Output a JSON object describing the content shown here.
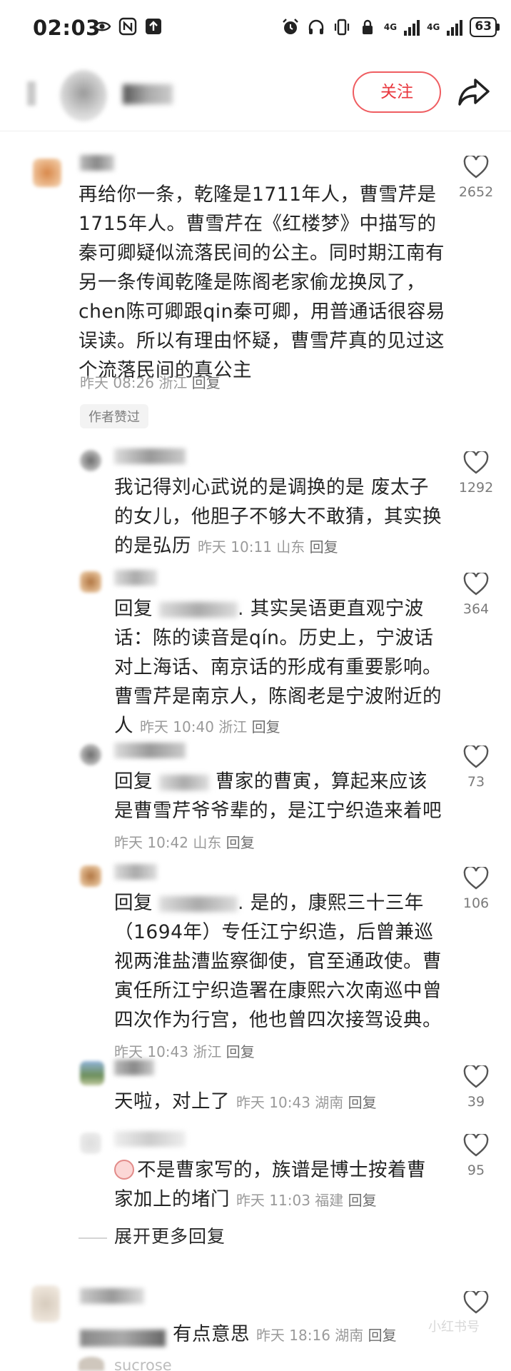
{
  "status_bar": {
    "time": "02:03",
    "network_1": "4G",
    "network_2": "4G",
    "battery": "63"
  },
  "header": {
    "follow_label": "关注"
  },
  "comments": [
    {
      "text": "再给你一条，乾隆是1711年人，曹雪芹是1715年人。曹雪芹在《红楼梦》中描写的秦可卿疑似流落民间的公主。同时期江南有另一条传闻乾隆是陈阁老家偷龙换凤了，chen陈可卿跟qin秦可卿，用普通话很容易误读。所以有理由怀疑，曹雪芹真的见过这个流落民间的真公主",
      "time": "昨天 08:26",
      "location": "浙江",
      "reply_label": "回复",
      "likes": "2652",
      "badge": "作者赞过"
    },
    {
      "text": "我记得刘心武说的是调换的是 废太子的女儿，他胆子不够大不敢猜，其实换的是弘历",
      "time": "昨天 10:11",
      "location": "山东",
      "reply_label": "回复",
      "likes": "1292"
    },
    {
      "prefix": "回复",
      "text": ". 其实吴语更直观宁波话：陈的读音是qín。历史上，宁波话对上海话、南京话的形成有重要影响。曹雪芹是南京人，陈阁老是宁波附近的人",
      "time": "昨天 10:40",
      "location": "浙江",
      "reply_label": "回复",
      "likes": "364"
    },
    {
      "prefix": "回复",
      "text": "曹家的曹寅，算起来应该是曹雪芹爷爷辈的，是江宁织造来着吧",
      "time": "昨天 10:42",
      "location": "山东",
      "reply_label": "回复",
      "likes": "73"
    },
    {
      "prefix": "回复",
      "text": ". 是的，康熙三十三年（1694年）专任江宁织造，后曾兼巡视两淮盐漕监察御使，官至通政使。曹寅任所江宁织造署在康熙六次南巡中曾四次作为行宫，他也曾四次接驾设典。",
      "time": "昨天 10:43",
      "location": "浙江",
      "reply_label": "回复",
      "likes": "106"
    },
    {
      "text": "天啦，对上了",
      "time": "昨天 10:43",
      "location": "湖南",
      "reply_label": "回复",
      "likes": "39"
    },
    {
      "text": "不是曹家写的，族谱是博士按着曹家加上的堵门",
      "time": "昨天 11:03",
      "location": "福建",
      "reply_label": "回复",
      "likes": "95"
    },
    {
      "text": "有点意思",
      "time": "昨天 18:16",
      "location": "湖南",
      "reply_label": "回复"
    }
  ],
  "expand_label": "展开更多回复",
  "watermark": "小红书号",
  "bottom_name": "sucrose",
  "colors": {
    "accent": "#e9373e",
    "meta": "#9a9a9a"
  }
}
